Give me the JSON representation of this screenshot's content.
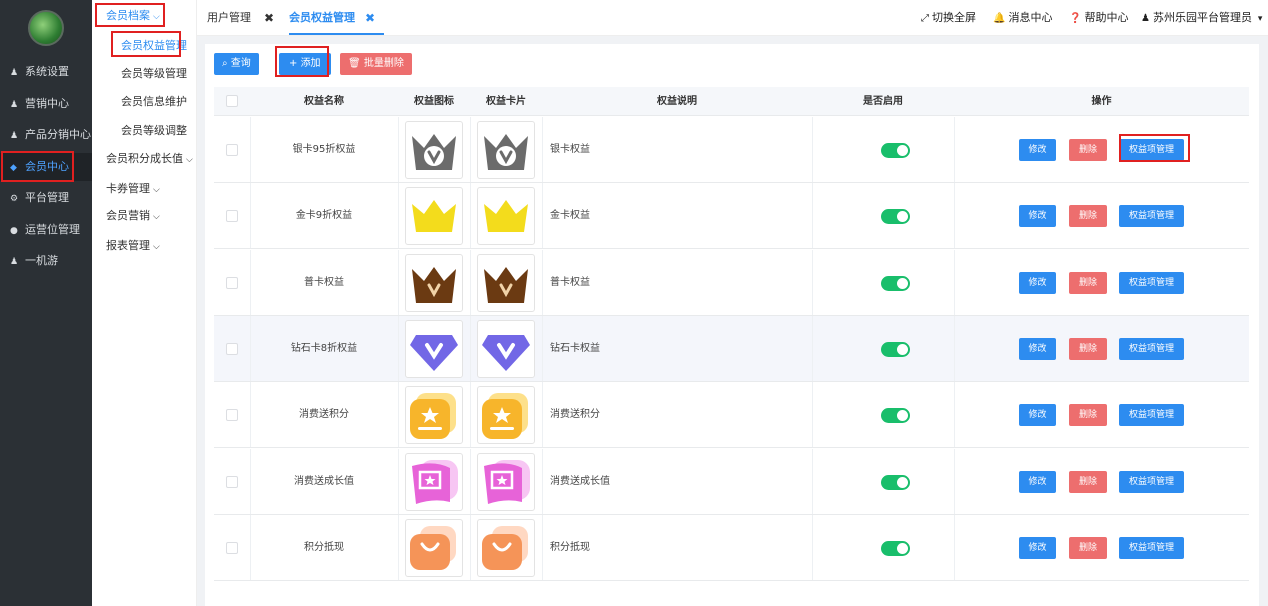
{
  "sidebar": {
    "items": [
      {
        "label": "系统设置",
        "icon": "user-icon"
      },
      {
        "label": "营销中心",
        "icon": "user-icon"
      },
      {
        "label": "产品分销中心",
        "icon": "user-icon"
      },
      {
        "label": "会员中心",
        "icon": "diamond-icon"
      },
      {
        "label": "平台管理",
        "icon": "gear-icon"
      },
      {
        "label": "运营位管理",
        "icon": "compass-icon"
      },
      {
        "label": "一机游",
        "icon": "user-icon"
      }
    ],
    "active_index": 3
  },
  "submenu": {
    "group_label": "会员档案",
    "items": [
      "会员权益管理",
      "会员等级管理",
      "会员信息维护",
      "会员等级调整"
    ],
    "groups": [
      "会员积分成长值",
      "卡券管理",
      "会员营销",
      "报表管理"
    ]
  },
  "topbar": {
    "tabs": [
      "用户管理",
      "会员权益管理"
    ],
    "fullscreen": "切换全屏",
    "messages": "消息中心",
    "help": "帮助中心",
    "user": "苏州乐园平台管理员"
  },
  "toolbar": {
    "query": "查询",
    "add": "添加",
    "batch_delete": "批量删除"
  },
  "table": {
    "headers": [
      "权益名称",
      "权益图标",
      "权益卡片",
      "权益说明",
      "是否启用",
      "操作"
    ],
    "rows": [
      {
        "name": "银卡95折权益",
        "desc": "银卡权益",
        "enabled": true,
        "icon": "silver-crown-icon"
      },
      {
        "name": "金卡9折权益",
        "desc": "金卡权益",
        "enabled": true,
        "icon": "gold-crown-icon"
      },
      {
        "name": "普卡权益",
        "desc": "普卡权益",
        "enabled": true,
        "icon": "bronze-crown-icon"
      },
      {
        "name": "钻石卡8折权益",
        "desc": "钻石卡权益",
        "enabled": true,
        "icon": "diamond-badge-icon"
      },
      {
        "name": "消费送积分",
        "desc": "消费送积分",
        "enabled": true,
        "icon": "star-ticket-icon"
      },
      {
        "name": "消费送成长值",
        "desc": "消费送成长值",
        "enabled": true,
        "icon": "star-flag-icon"
      },
      {
        "name": "积分抵现",
        "desc": "积分抵现",
        "enabled": true,
        "icon": "shopping-bag-icon"
      }
    ],
    "actions": {
      "edit": "修改",
      "delete": "删除",
      "manage": "权益项管理"
    }
  },
  "colors": {
    "primary": "#2d8cf0",
    "danger": "#ed6e6e",
    "switch_on": "#19be6b",
    "sidebar_bg": "#2b3035"
  }
}
